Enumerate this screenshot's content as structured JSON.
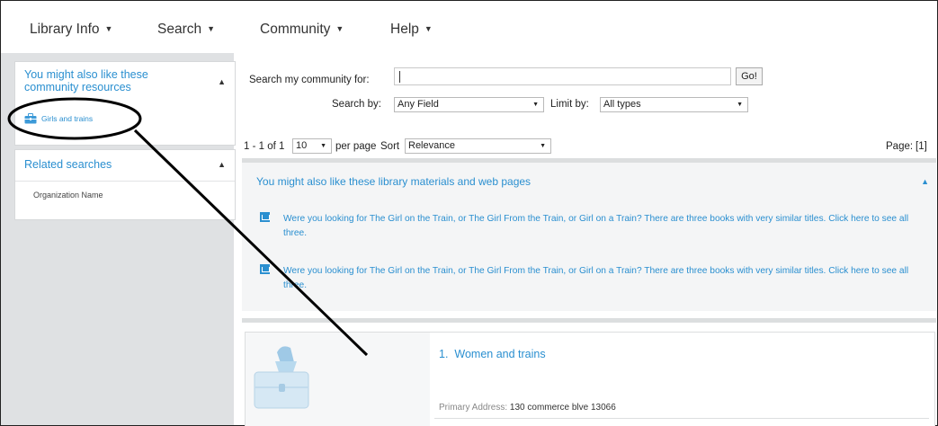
{
  "nav": {
    "library_info": "Library Info",
    "search": "Search",
    "community": "Community",
    "help": "Help"
  },
  "sidebar": {
    "community_title": "You might also like these community resources",
    "community_item": "Girls and trains",
    "related_title": "Related searches",
    "related_item": "Organization Name"
  },
  "search_form": {
    "search_label": "Search my community for:",
    "search_value": "",
    "go_label": "Go!",
    "search_by_label": "Search by:",
    "search_by_value": "Any Field",
    "limit_by_label": "Limit by:",
    "limit_by_value": "All types"
  },
  "results_bar": {
    "range": "1 - 1 of 1",
    "per_page_value": "10",
    "per_page_label": "per page",
    "sort_label": "Sort",
    "sort_value": "Relevance",
    "page_label": "Page:",
    "page_value": "[1]"
  },
  "suggestions": {
    "title": "You might also like these library materials and web pages",
    "items": [
      "Were you looking for The Girl on the Train, or The Girl From the Train, or Girl on a Train? There are three books with very similar titles. Click here to see all three.",
      "Were you looking for The Girl on the Train, or The Girl From the Train, or Girl on a Train? There are three books with very similar titles. Click here to see all three."
    ]
  },
  "result": {
    "number": "1.",
    "title": "Women and trains",
    "address_label": "Primary Address:",
    "address_value": "130 commerce blve 13066"
  },
  "colors": {
    "link": "#2a8fd0",
    "sidebar_bg": "#dfe1e3",
    "annotation": "#000000"
  },
  "icons": {
    "caret": "caret-down-icon",
    "collapse": "caret-up-icon",
    "community_item": "briefcase-icon",
    "suggestion": "external-link-icon"
  }
}
